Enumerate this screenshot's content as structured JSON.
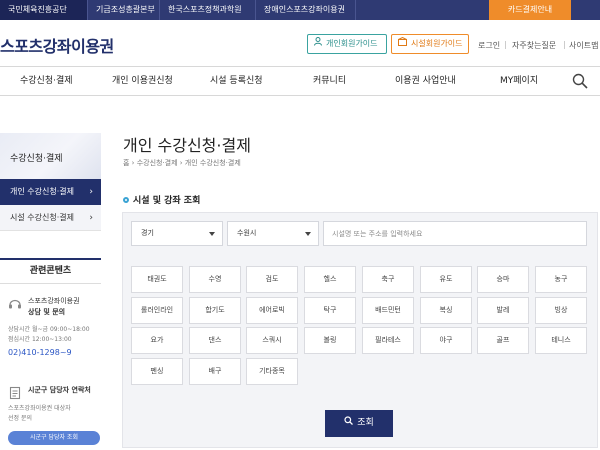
{
  "top_links": {
    "org": "국민체육진흥공단",
    "fund": "기금조성총괄본부",
    "institute": "한국스포츠정책과학원",
    "disabled": "장애인스포츠강좌이용권",
    "card": "카드결제안내"
  },
  "header": {
    "logo": "스포츠강좌이용권",
    "personal_guide": "개인회원가이드",
    "facility_guide": "시설회원가이드",
    "login": "로그인",
    "faq": "자주찾는질문",
    "sitemap": "사이트맵"
  },
  "gnb": {
    "items": [
      "수강신청·결제",
      "개인 이용권신청",
      "시설 등록신청",
      "커뮤니티",
      "이용권 사업안내",
      "MY페이지"
    ]
  },
  "sidebar": {
    "title": "수강신청·결제",
    "items": [
      "개인 수강신청·결제",
      "시설 수강신청·결제"
    ],
    "related": {
      "title": "관련콘텐츠",
      "consult_title1": "스포츠강좌이용권",
      "consult_title2": "상담 및 문의",
      "hours1": "상담시간 월~금 09:00~18:00",
      "hours2": "점심시간 12:00~13:00",
      "phone": "02)410-1298~9",
      "district_title": "시군구 담당자 연락처",
      "district_desc1": "스포츠강좌이용권 대상자",
      "district_desc2": "선정 문의",
      "district_button": "시군구 담당자 조회"
    }
  },
  "main": {
    "title": "개인 수강신청·결제",
    "breadcrumb": "홈 › 수강신청·결제 › 개인 수강신청·결제",
    "section_title": "시설 및 강좌 조회",
    "province": "경기",
    "city": "수원시",
    "search_placeholder": "시설명 또는 주소를 입력하세요",
    "search_button": "조회",
    "sports": [
      "태권도",
      "수영",
      "검도",
      "헬스",
      "축구",
      "유도",
      "승마",
      "농구",
      "롤러인라인",
      "합기도",
      "에어로빅",
      "탁구",
      "배드민턴",
      "복싱",
      "발레",
      "빙상",
      "요가",
      "댄스",
      "스쿼시",
      "볼링",
      "필라테스",
      "야구",
      "골프",
      "테니스",
      "펜싱",
      "배구",
      "기타종목"
    ]
  }
}
